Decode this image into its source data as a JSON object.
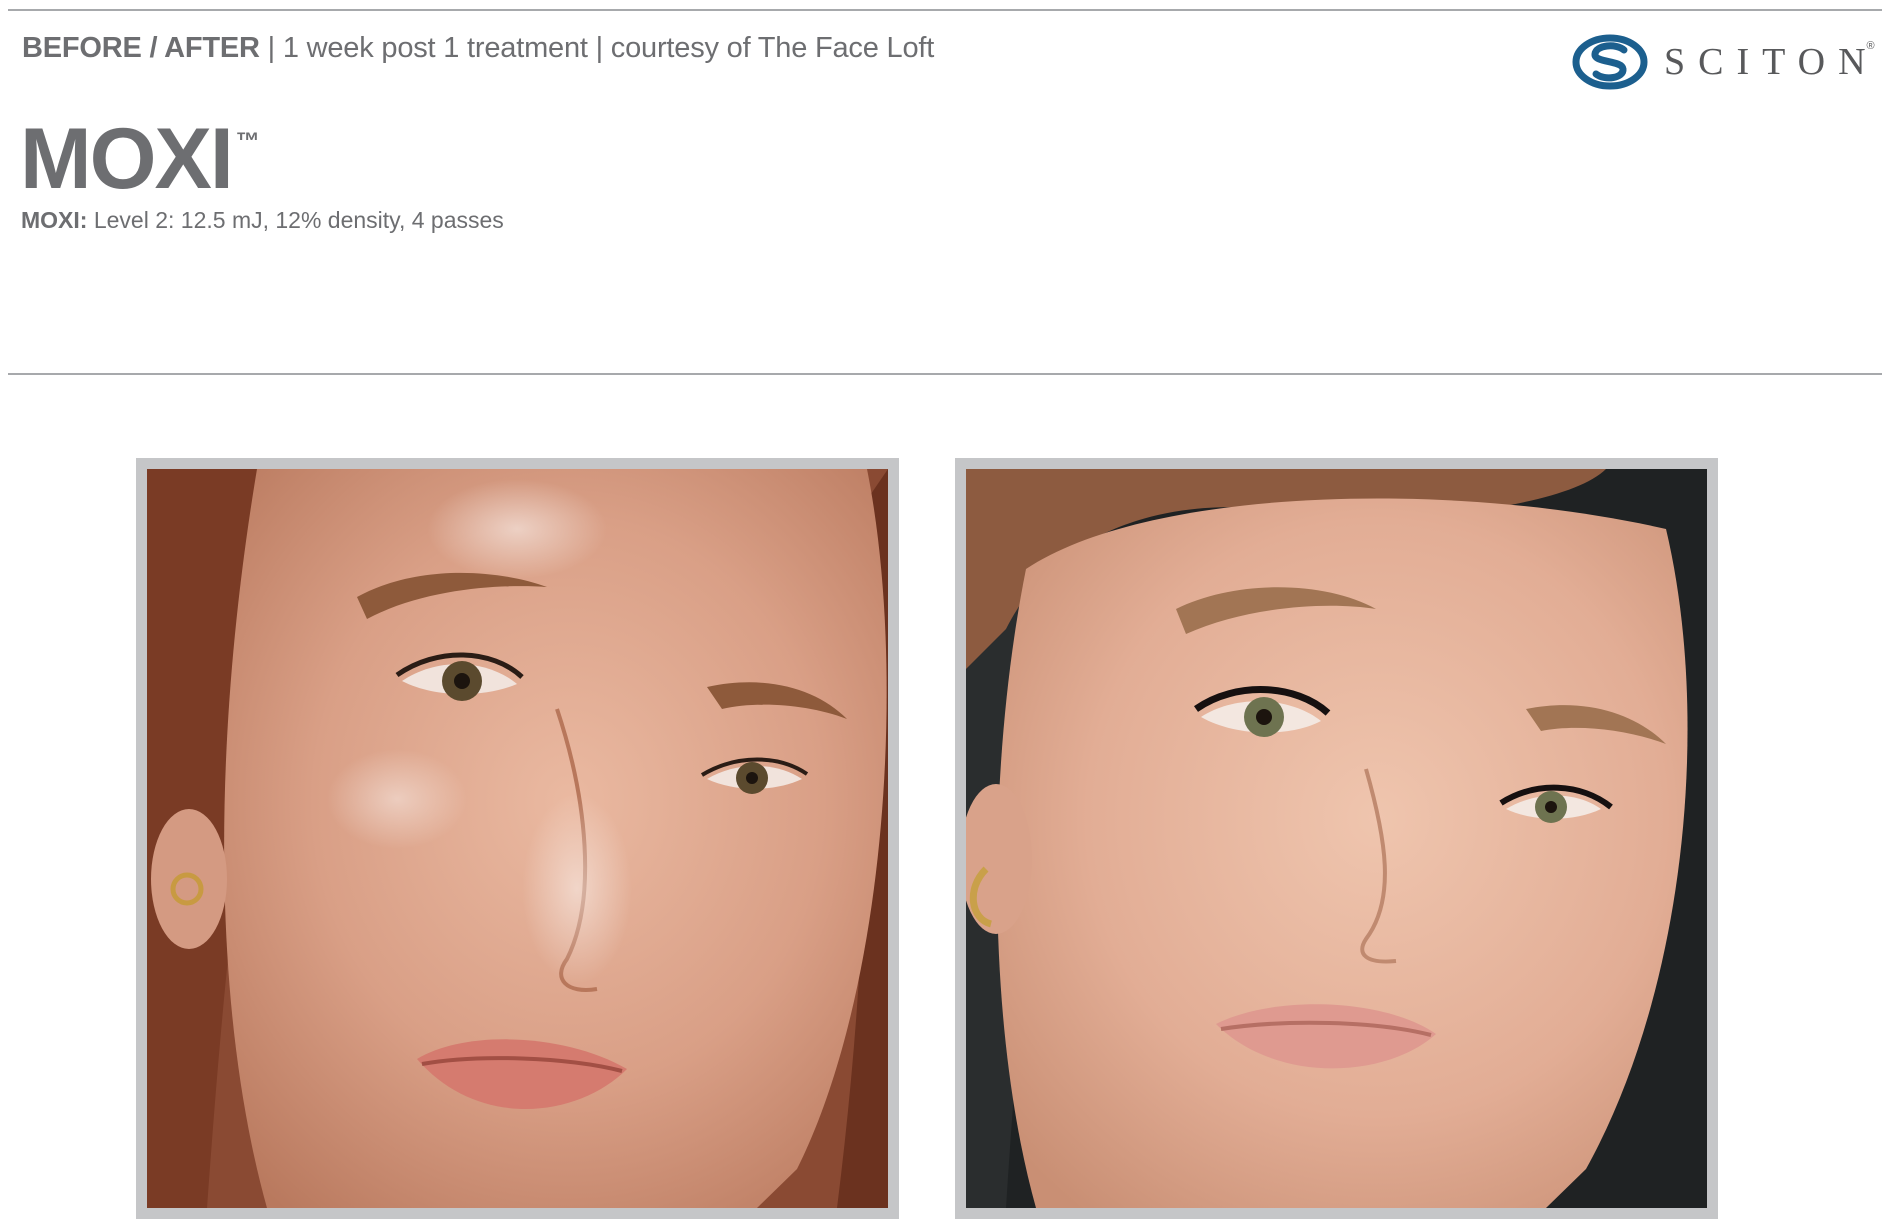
{
  "header": {
    "label_strong": "BEFORE / AFTER",
    "label_rest": " | 1 week post 1 treatment | courtesy of The Face Loft"
  },
  "title": {
    "text": "MOXI",
    "trademark": "™"
  },
  "settings": {
    "label": "MOXI:",
    "value": " Level 2: 12.5 mJ, 12% density, 4 passes"
  },
  "logo": {
    "wordmark": "SCITON",
    "registered": "®",
    "icon": "sciton-swirl-icon"
  },
  "colors": {
    "text_gray": "#6d6e71",
    "rule_gray": "#a7a9ac",
    "frame_gray": "#c5c6c8",
    "logo_blue": "#1c5f8e"
  },
  "photos": [
    {
      "role": "before"
    },
    {
      "role": "after"
    }
  ]
}
